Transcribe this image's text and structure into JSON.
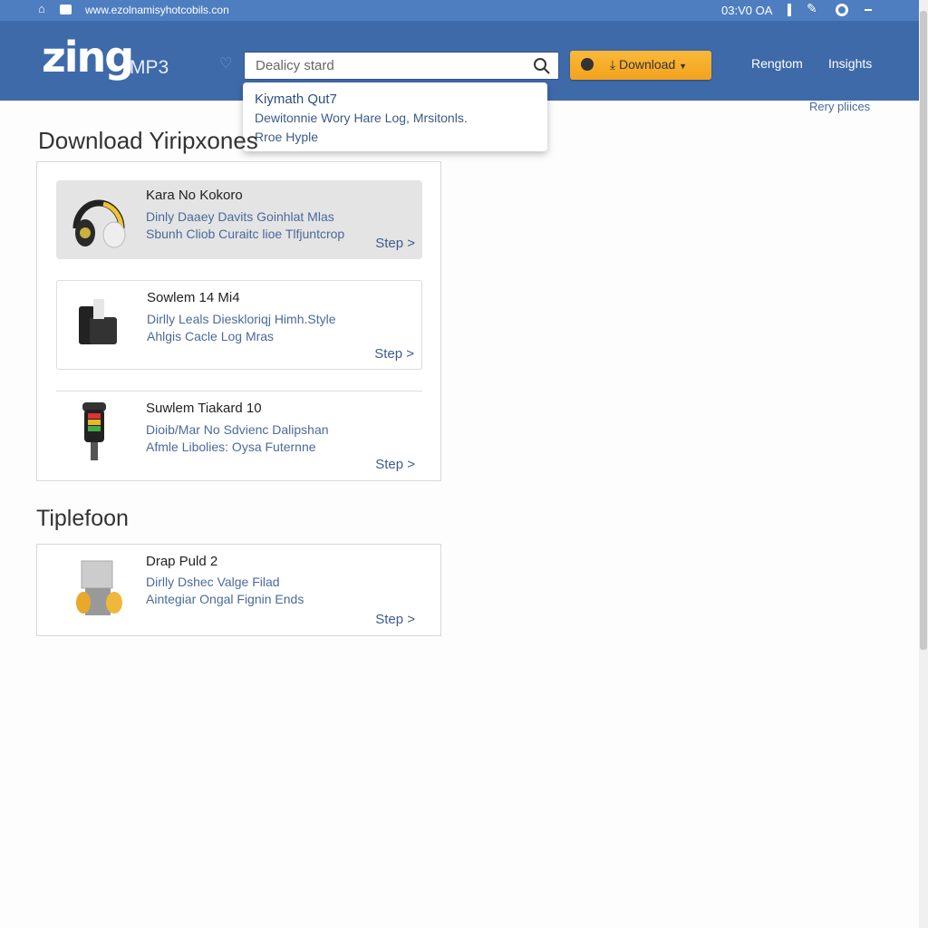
{
  "statusbar": {
    "url": "www.ezolnamisyhotcobils.con",
    "time": "03:V0 OA"
  },
  "header": {
    "logo": "zing",
    "logo_suffix": "MP3",
    "search_value": "Dealicy stard",
    "download_label": "Download",
    "nav": [
      "Rengtom",
      "Insights"
    ],
    "brand_color": "#3f6aa9",
    "accent": "#f5a623"
  },
  "suggestion": {
    "title": "Kiymath Qut7",
    "line1": "Dewitonnie Wory Hare Log, Mrsitonls.",
    "line2": "Rroe Hyple"
  },
  "side_link": "Rery pliices",
  "section1": {
    "title": "Download Yiripxones",
    "items": [
      {
        "title": "Kara No Kokoro",
        "line1": "Dinly Daaey Davits Goinhlat Mlas",
        "line2": "Sbunh Cliob Curaitc lioe Tlfjuntcrop",
        "action": "Step >",
        "icon": "headphones-icon"
      },
      {
        "title": "Sowlem 14 Mi4",
        "line1": "Dirlly Leals Dieskloriqj Himh.Style",
        "line2": "Ahlgis Cacle Log Mras",
        "action": "Step >",
        "icon": "device-icon"
      },
      {
        "title": "Suwlem Tiakard 10",
        "line1": "Dioib/Mar No Sdvienc Dalipshan",
        "line2": "Afmle Libolies: Oysa Futernne",
        "action": "Step >",
        "icon": "player-icon"
      }
    ]
  },
  "section2": {
    "title": "Tiplefoon",
    "items": [
      {
        "title": "Drap Puld 2",
        "line1": "Dirlly Dshec Valge Filad",
        "line2": "Aintegiar Ongal Fignin Ends",
        "action": "Step >",
        "icon": "speaker-icon"
      }
    ]
  }
}
